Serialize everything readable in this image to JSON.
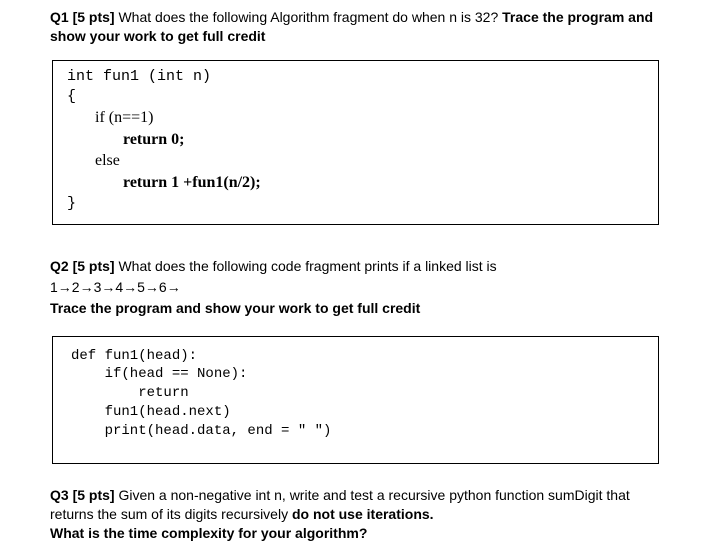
{
  "q1": {
    "label": "Q1 [5 pts] ",
    "prompt": "What does the following Algorithm fragment do when n is 32? ",
    "tail": "Trace the program and show your work to get full credit",
    "code": {
      "l1": "int fun1 (int n)",
      "l2": "{",
      "l3": "       if (n==1)",
      "l4": "              return 0;",
      "l5": "       else",
      "l6": "              return 1 +fun1(n/2);",
      "l7": "}"
    }
  },
  "q2": {
    "label": "Q2 [5 pts] ",
    "prompt": "What does the following code fragment prints if a linked list is",
    "list": "1→2→3→4→5→6→",
    "trace": " Trace the program and show your work to get full credit",
    "code": {
      "l1": "def fun1(head):",
      "l2": "    if(head == None):",
      "l3": "        return",
      "l4": "    fun1(head.next)",
      "l5": "    print(head.data, end = \" \")"
    }
  },
  "q3": {
    "label": "Q3 [5 pts] ",
    "prompt1": "Given a non-negative int n, write and test a recursive python function sumDigit that returns the sum of its digits recursively ",
    "bold1": "do not use iterations.",
    "bold2": "What is the time complexity for your algorithm?"
  }
}
